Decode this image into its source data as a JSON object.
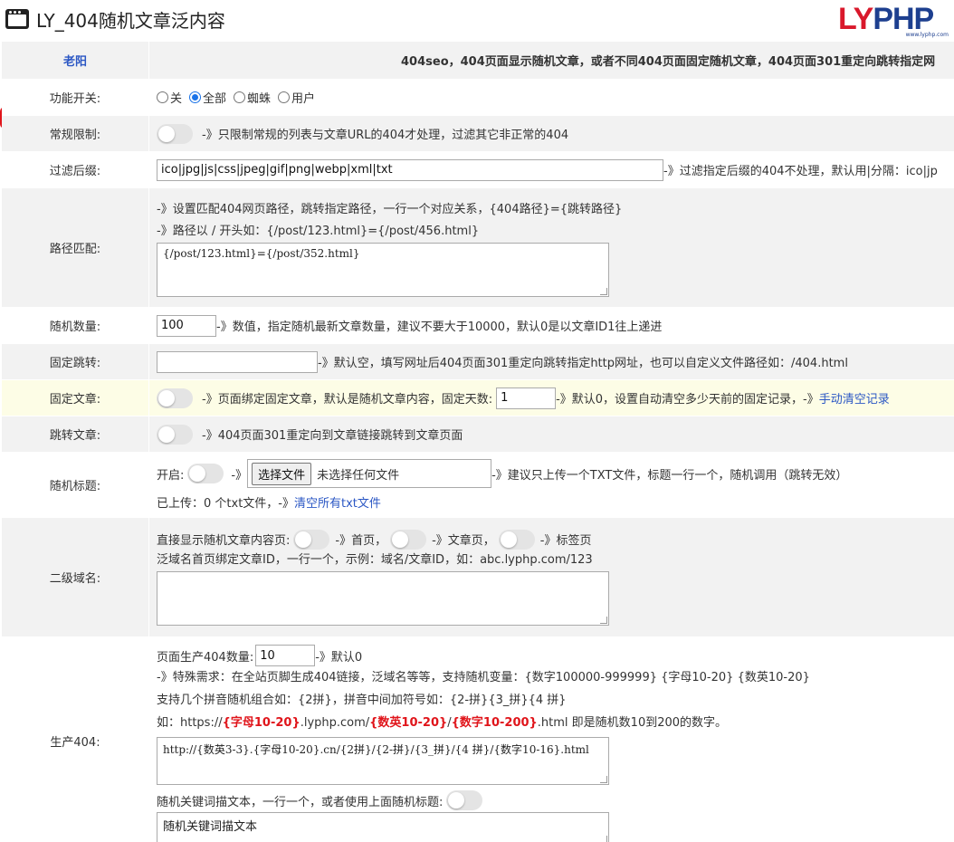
{
  "window": {
    "title": "LY_404随机文章泛内容"
  },
  "logo": {
    "text_ly": "LY",
    "text_php": "PHP",
    "sub": "www.lyphp.com"
  },
  "header": {
    "author": "老阳",
    "description": "404seo，404页面显示随机文章，或者不同404页面固定随机文章，404页面301重定向跳转指定网"
  },
  "rows": {
    "feature": {
      "label": "功能开关:",
      "options": [
        "关",
        "全部",
        "蜘蛛",
        "用户"
      ],
      "selected": "全部"
    },
    "normal": {
      "label": "常规限制:",
      "note": "-》只限制常规的列表与文章URL的404才处理，过滤其它非正常的404"
    },
    "suffix": {
      "label": "过滤后缀:",
      "value": "ico|jpg|js|css|jpeg|gif|png|webp|xml|txt",
      "note": "-》过滤指定后缀的404不处理，默认用|分隔：ico|jp"
    },
    "path": {
      "label": "路径匹配:",
      "note1": "-》设置匹配404网页路径，跳转指定路径，一行一个对应关系，{404路径}={跳转路径}",
      "note2": "-》路径以 / 开头如：{/post/123.html}={/post/456.html}",
      "value": "{/post/123.html}={/post/352.html}"
    },
    "count": {
      "label": "随机数量:",
      "value": "100",
      "note": "-》数值，指定随机最新文章数量，建议不要大于10000，默认0是以文章ID1往上递进"
    },
    "fixed_jump": {
      "label": "固定跳转:",
      "value": "",
      "note": "-》默认空，填写网址后404页面301重定向跳转指定http网址，也可以自定义文件路径如：/404.html"
    },
    "fixed_article": {
      "label": "固定文章:",
      "note1": "-》页面绑定固定文章，默认是随机文章内容，固定天数:",
      "days": "1",
      "note2": "-》默认0，设置自动清空多少天前的固定记录，-》",
      "link": "手动清空记录"
    },
    "jump_article": {
      "label": "跳转文章:",
      "note": "-》404页面301重定向到文章链接跳转到文章页面"
    },
    "random_title": {
      "label": "随机标题:",
      "open": "开启:",
      "arrow": "-》",
      "button": "选择文件",
      "file_status": "未选择任何文件",
      "note": "-》建议只上传一个TXT文件，标题一行一个，随机调用（跳转无效）",
      "uploaded": "已上传：0 个txt文件，-》",
      "link": "清空所有txt文件"
    },
    "subdomain": {
      "label": "二级域名:",
      "line1": "直接显示随机文章内容页:",
      "home": "-》首页，",
      "article": "-》文章页，",
      "tag": "-》标签页",
      "line2": "泛域名首页绑定文章ID，一行一个，示例：域名/文章ID，如：abc.lyphp.com/123",
      "value": ""
    },
    "gen404": {
      "label": "生产404:",
      "count_label": "页面生产404数量:",
      "count_value": "10",
      "count_note": "-》默认0",
      "note1": "-》特殊需求：在全站页脚生成404链接，泛域名等等，支持随机变量：{数字100000-999999} {字母10-20} {数英10-20}",
      "note2": "支持几个拼音随机组合如：{2拼}，拼音中间加符号如：{2-拼}{3_拼}{4 拼}",
      "ex_prefix": "如：https://",
      "ex_r1": "{字母10-20}",
      "ex_mid1": ".lyphp.com/",
      "ex_r2": "{数英10-20}",
      "ex_mid2": "/",
      "ex_r3": "{数字10-200}",
      "ex_suffix": ".html 即是随机数10到200的数字。",
      "value": "http://{数英3-3}.{字母10-20}.cn/{2拼}/{2-拼}/{3_拼}/{4 拼}/{数字10-16}.html",
      "kw_label": "随机关键词描文本，一行一个，或者使用上面随机标题:",
      "kw_value": "随机关键词描文本"
    }
  }
}
